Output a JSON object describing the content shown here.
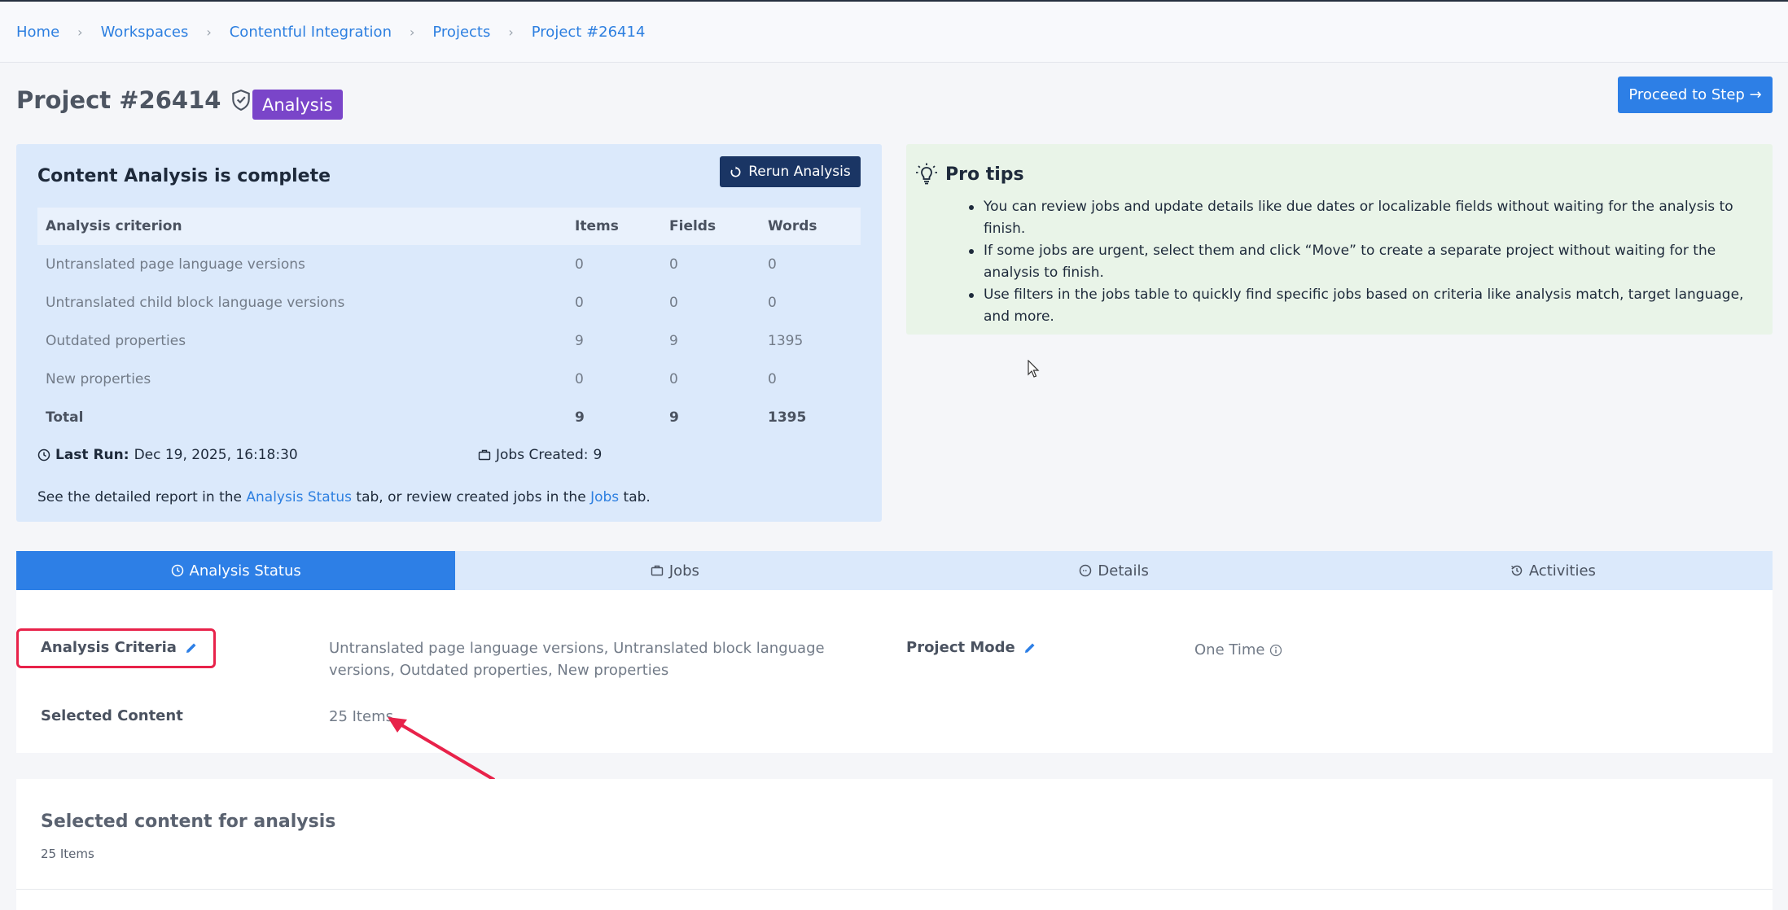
{
  "breadcrumb": [
    "Home",
    "Workspaces",
    "Contentful Integration",
    "Projects",
    "Project #26414"
  ],
  "header": {
    "title": "Project #26414",
    "badge": "Analysis",
    "badge_color": "#7a45c9",
    "proceed_label": "Proceed to Step →"
  },
  "analysis": {
    "title": "Content Analysis is complete",
    "rerun_label": "Rerun Analysis",
    "columns": [
      "Analysis criterion",
      "Items",
      "Fields",
      "Words"
    ],
    "rows": [
      {
        "criterion": "Untranslated page language versions",
        "items": "0",
        "fields": "0",
        "words": "0"
      },
      {
        "criterion": "Untranslated child block language versions",
        "items": "0",
        "fields": "0",
        "words": "0"
      },
      {
        "criterion": "Outdated properties",
        "items": "9",
        "fields": "9",
        "words": "1395"
      },
      {
        "criterion": "New properties",
        "items": "0",
        "fields": "0",
        "words": "0"
      }
    ],
    "total": {
      "label": "Total",
      "items": "9",
      "fields": "9",
      "words": "1395"
    },
    "last_run_label": "Last Run:",
    "last_run_value": "Dec 19, 2025, 16:18:30",
    "jobs_created_label": "Jobs Created:",
    "jobs_created_value": "9",
    "report_prefix": "See the detailed report in the",
    "report_link1": "Analysis Status",
    "report_middle": "tab, or review created jobs in the",
    "report_link2": "Jobs",
    "report_suffix": "tab."
  },
  "tips": {
    "title": "Pro tips",
    "items": [
      "You can review jobs and update details like due dates or localizable fields without waiting for the analysis to finish.",
      "If some jobs are urgent, select them and click “Move” to create a separate project without waiting for the analysis to finish.",
      "Use filters in the jobs table to quickly find specific jobs based on criteria like analysis match, target language, and more."
    ]
  },
  "tabs": [
    {
      "label": "Analysis Status",
      "icon": "clock-icon",
      "active": true
    },
    {
      "label": "Jobs",
      "icon": "briefcase-icon",
      "active": false
    },
    {
      "label": "Details",
      "icon": "dots-circle-icon",
      "active": false
    },
    {
      "label": "Activities",
      "icon": "history-icon",
      "active": false
    }
  ],
  "details": {
    "criteria_label": "Analysis Criteria",
    "criteria_value": "Untranslated page language versions, Untranslated block language versions, Outdated properties, New properties",
    "project_mode_label": "Project Mode",
    "project_mode_value": "One Time",
    "selected_content_label": "Selected Content",
    "selected_content_value": "25 Items"
  },
  "selected_section": {
    "title": "Selected content for analysis",
    "subtitle": "25 Items"
  },
  "colors": {
    "accent": "#2d7fe6",
    "highlight": "#e8224a",
    "tips_bg": "#e9f4e8",
    "analysis_bg": "#dbe9fb"
  }
}
